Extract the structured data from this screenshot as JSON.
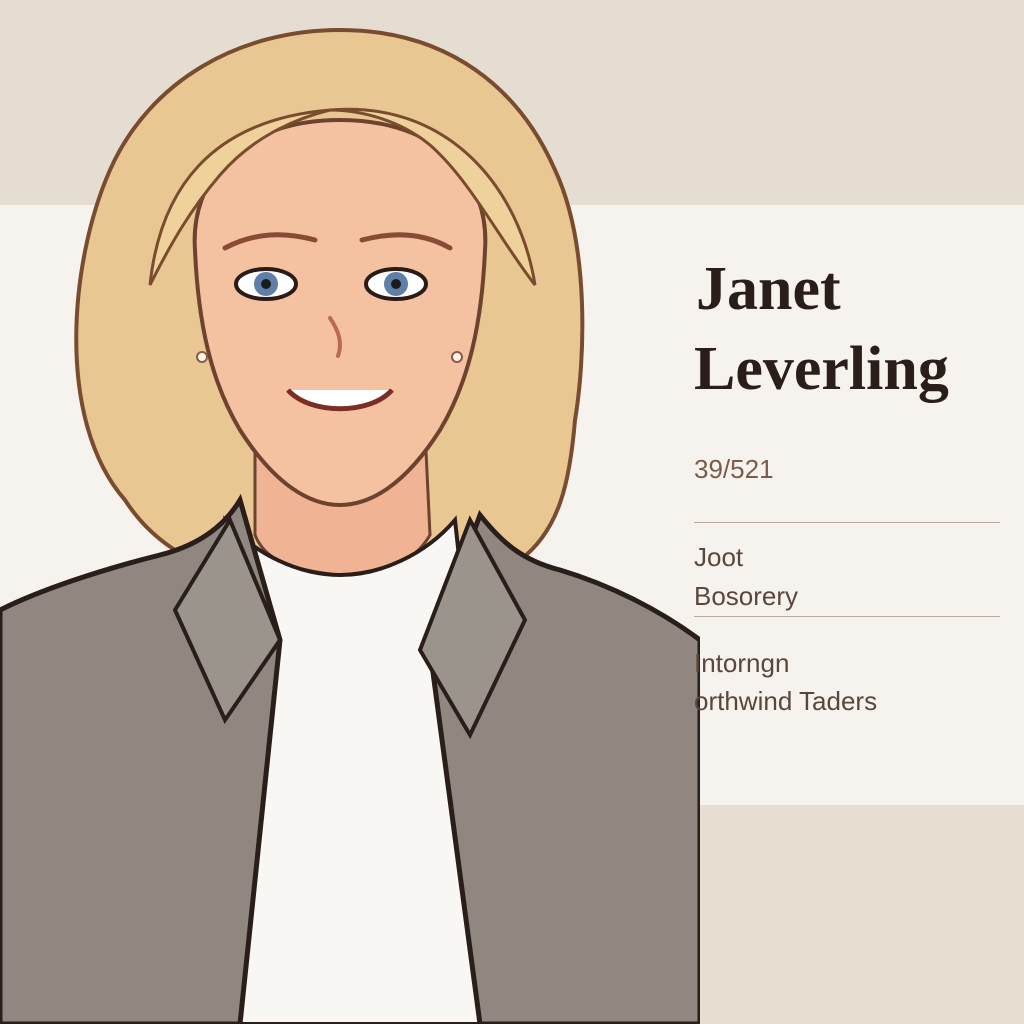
{
  "profile": {
    "first_name": "Janet",
    "last_name": "Leverling",
    "stat": "39/521",
    "line1": "Joot",
    "line2": "Bosorery",
    "line3": "Intorngn",
    "line4": "orthwind Taders"
  },
  "colors": {
    "top_band": "#e5ddd1",
    "panel": "#f6f3ee",
    "bottom_band": "#e7ddd0",
    "hair": "#e9c793",
    "skin": "#f4c2a1",
    "blazer": "#8f8780",
    "shirt": "#f8f7f4",
    "eyes": "#5f7fa8"
  },
  "icons": [
    "portrait-illustration"
  ]
}
